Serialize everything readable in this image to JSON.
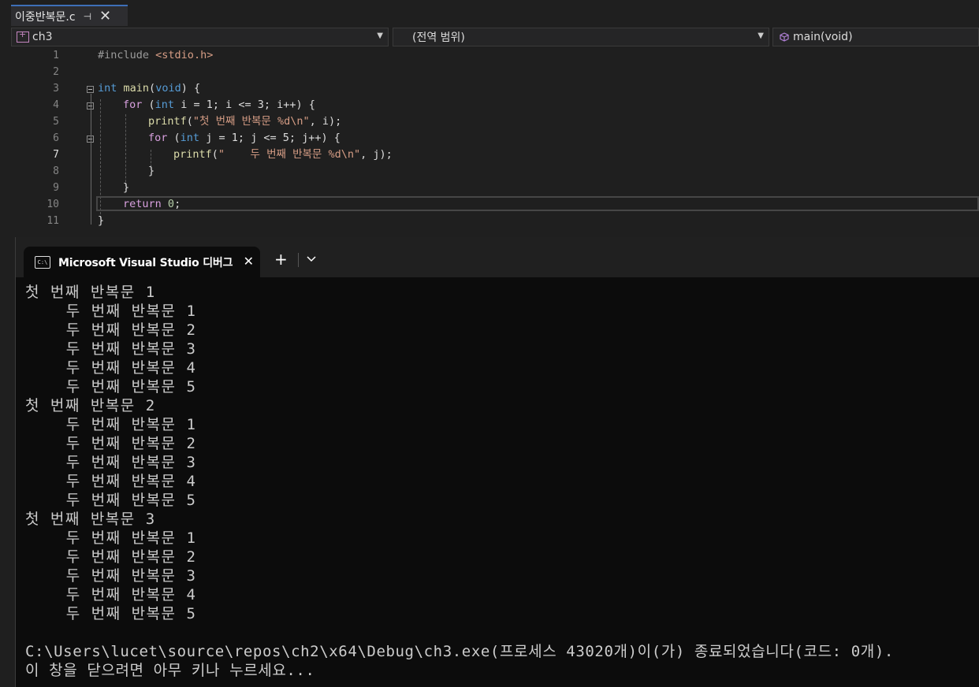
{
  "editor": {
    "tab_title": "이중반복문.c",
    "project": "ch3",
    "scope": "(전역 범위)",
    "function": "main(void)",
    "line_numbers": [
      "1",
      "2",
      "3",
      "4",
      "5",
      "6",
      "7",
      "8",
      "9",
      "10",
      "11"
    ],
    "current_line": "7",
    "code": {
      "l1_include": "#include",
      "l1_header": "<stdio.h>",
      "l3_int": "int",
      "l3_main": "main",
      "l3_void": "void",
      "l4_for": "for",
      "l4_int": "int",
      "l4_rest": "i = 1; i <= 3; i++) {",
      "l5_printf": "printf",
      "l5_str": "\"첫 번째 반복문 %d\\n\"",
      "l5_tail": ", i);",
      "l6_for": "for",
      "l6_int": "int",
      "l6_rest": "j = 1; j <= 5; j++) {",
      "l7_printf": "printf",
      "l7_str": "\"    두 번째 반복문 %d\\n\"",
      "l7_tail": ", j);",
      "l8": "}",
      "l9": "}",
      "l10_return": "return",
      "l10_zero": "0",
      "l11": "}"
    }
  },
  "terminal": {
    "title": "Microsoft Visual Studio 디버그",
    "icon_text": "C:\\",
    "lines": [
      "첫 번째 반복문 1",
      "    두 번째 반복문 1",
      "    두 번째 반복문 2",
      "    두 번째 반복문 3",
      "    두 번째 반복문 4",
      "    두 번째 반복문 5",
      "첫 번째 반복문 2",
      "    두 번째 반복문 1",
      "    두 번째 반복문 2",
      "    두 번째 반복문 3",
      "    두 번째 반복문 4",
      "    두 번째 반복문 5",
      "첫 번째 반복문 3",
      "    두 번째 반복문 1",
      "    두 번째 반복문 2",
      "    두 번째 반복문 3",
      "    두 번째 반복문 4",
      "    두 번째 반복문 5"
    ],
    "exit_message": "C:\\Users\\lucet\\source\\repos\\ch2\\x64\\Debug\\ch3.exe(프로세스 43020개)이(가) 종료되었습니다(코드: 0개).",
    "prompt_message": "이 창을 닫으려면 아무 키나 누르세요..."
  }
}
